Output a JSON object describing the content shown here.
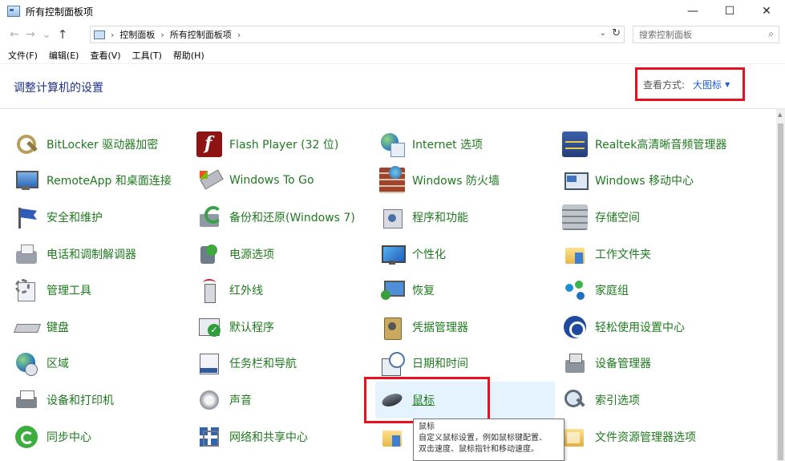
{
  "window": {
    "title": "所有控制面板项",
    "minimize": "—",
    "maximize": "☐",
    "close": "✕"
  },
  "addressbar": {
    "back": "←",
    "forward": "→",
    "recent": "⌄",
    "up": "↑",
    "crumbs": [
      "控制面板",
      "所有控制面板项"
    ],
    "separator": "›",
    "dropdown": "⌄",
    "refresh": "↻",
    "search_placeholder": "搜索控制面板",
    "search_icon": "⌕"
  },
  "menubar": {
    "items": [
      "文件(F)",
      "编辑(E)",
      "查看(V)",
      "工具(T)",
      "帮助(H)"
    ]
  },
  "header": {
    "title": "调整计算机的设置",
    "view_label": "查看方式:",
    "view_value": "大图标",
    "view_arrow": "▼"
  },
  "items": [
    {
      "label": "BitLocker 驱动器加密",
      "icon": "bitlocker-icon"
    },
    {
      "label": "Flash Player (32 位)",
      "icon": "flash-player-icon"
    },
    {
      "label": "Internet 选项",
      "icon": "internet-options-icon"
    },
    {
      "label": "Realtek高清晰音频管理器",
      "icon": "realtek-audio-icon"
    },
    {
      "label": "RemoteApp 和桌面连接",
      "icon": "remoteapp-icon"
    },
    {
      "label": "Windows To Go",
      "icon": "windows-to-go-icon"
    },
    {
      "label": "Windows 防火墙",
      "icon": "firewall-icon"
    },
    {
      "label": "Windows 移动中心",
      "icon": "mobility-center-icon"
    },
    {
      "label": "安全和维护",
      "icon": "security-flag-icon"
    },
    {
      "label": "备份和还原(Windows 7)",
      "icon": "backup-restore-icon"
    },
    {
      "label": "程序和功能",
      "icon": "programs-features-icon"
    },
    {
      "label": "存储空间",
      "icon": "storage-spaces-icon"
    },
    {
      "label": "电话和调制解调器",
      "icon": "phone-modem-icon"
    },
    {
      "label": "电源选项",
      "icon": "power-options-icon"
    },
    {
      "label": "个性化",
      "icon": "personalization-icon"
    },
    {
      "label": "工作文件夹",
      "icon": "work-folders-icon"
    },
    {
      "label": "管理工具",
      "icon": "admin-tools-icon"
    },
    {
      "label": "红外线",
      "icon": "infrared-icon"
    },
    {
      "label": "恢复",
      "icon": "recovery-icon"
    },
    {
      "label": "家庭组",
      "icon": "homegroup-icon"
    },
    {
      "label": "键盘",
      "icon": "keyboard-icon"
    },
    {
      "label": "默认程序",
      "icon": "default-programs-icon"
    },
    {
      "label": "凭据管理器",
      "icon": "credential-manager-icon"
    },
    {
      "label": "轻松使用设置中心",
      "icon": "ease-of-access-icon"
    },
    {
      "label": "区域",
      "icon": "region-icon"
    },
    {
      "label": "任务栏和导航",
      "icon": "taskbar-navigation-icon"
    },
    {
      "label": "日期和时间",
      "icon": "date-time-icon"
    },
    {
      "label": "设备管理器",
      "icon": "device-manager-icon"
    },
    {
      "label": "设备和打印机",
      "icon": "devices-printers-icon"
    },
    {
      "label": "声音",
      "icon": "sound-icon"
    },
    {
      "label": "鼠标",
      "icon": "mouse-icon"
    },
    {
      "label": "索引选项",
      "icon": "indexing-options-icon"
    },
    {
      "label": "同步中心",
      "icon": "sync-center-icon"
    },
    {
      "label": "网络和共享中心",
      "icon": "network-sharing-icon"
    },
    {
      "label": "",
      "icon": "file-history-icon"
    },
    {
      "label": "文件资源管理器选项",
      "icon": "explorer-options-icon"
    }
  ],
  "tooltip": {
    "title": "鼠标",
    "line1": "自定义鼠标设置，例如鼠标键配置、",
    "line2": "双击速度、鼠标指针和移动速度。"
  },
  "colors": {
    "link_green": "#1f7a1f",
    "title_blue": "#1e3287",
    "highlight_red": "#e8101f",
    "hover_bg": "#e5f3ff"
  }
}
